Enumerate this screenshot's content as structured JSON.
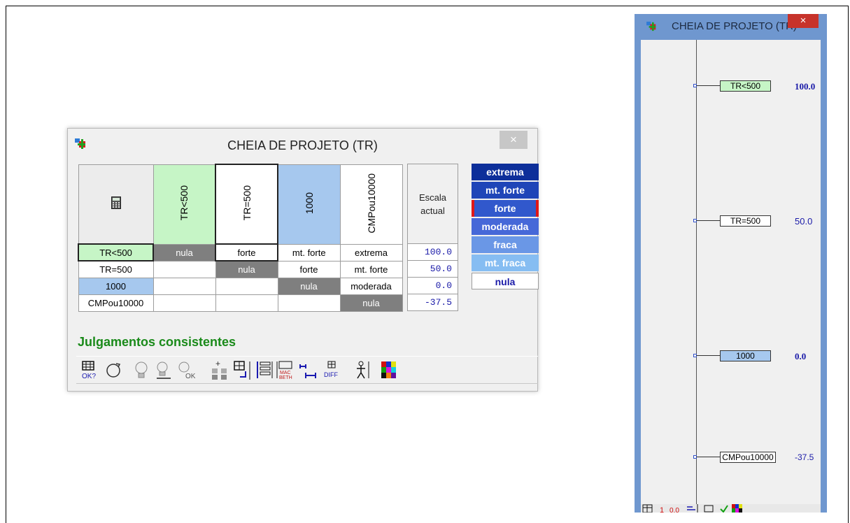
{
  "main_window": {
    "title": "CHEIA DE PROJETO (TR)",
    "close_symbol": "×",
    "headers": [
      "TR<500",
      "TR=500",
      "1000",
      "CMPou10000"
    ],
    "calc_icon": "calculator-icon",
    "rows": [
      {
        "label": "TR<500",
        "cells": [
          "nula",
          "forte",
          "mt. forte",
          "extrema"
        ]
      },
      {
        "label": "TR=500",
        "cells": [
          "",
          "nula",
          "forte",
          "mt. forte"
        ]
      },
      {
        "label": "1000",
        "cells": [
          "",
          "",
          "nula",
          "moderada"
        ]
      },
      {
        "label": "CMPou10000",
        "cells": [
          "",
          "",
          "",
          "nula"
        ]
      }
    ],
    "scale_header_1": "Escala",
    "scale_header_2": "actual",
    "scale_values": [
      "100.0",
      "50.0",
      "0.0",
      "-37.5"
    ],
    "legend": [
      "extrema",
      "mt. forte",
      "forte",
      "moderada",
      "fraca",
      "mt. fraca",
      "nula"
    ],
    "status": "Julgamentos consistentes",
    "colors": {
      "green": "#c6f5c6",
      "blue": "#a6c8ee",
      "legend_dark": "#0d2f9a",
      "legend_mid": "#4668d8",
      "legend_light": "#7fb3f0",
      "status": "#1a8a1a"
    }
  },
  "side_window": {
    "title": "CHEIA DE PROJETO (TR)",
    "close_symbol": "×",
    "items": [
      {
        "label": "TR<500",
        "value": "100.0"
      },
      {
        "label": "TR=500",
        "value": "50.0"
      },
      {
        "label": "1000",
        "value": "0.0"
      },
      {
        "label": "CMPou10000",
        "value": "-37.5"
      }
    ]
  }
}
